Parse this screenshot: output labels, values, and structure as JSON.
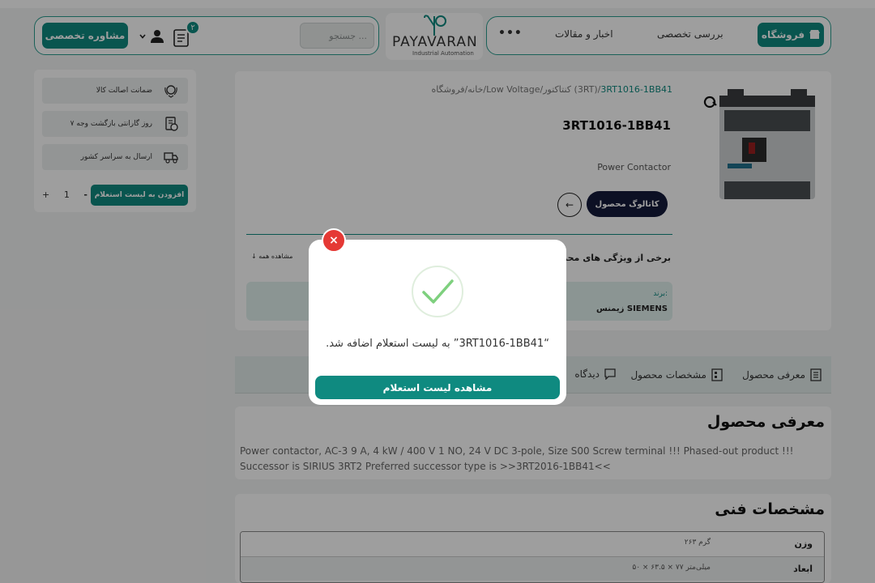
{
  "header": {
    "consult_label": "مشاوره تخصصی",
    "cart_count": "۲",
    "search_placeholder": "جستجو ...",
    "logo_text": "PAYAVARAN",
    "logo_sub": "Industrial Automation",
    "shop_label": "فروشگاه",
    "nav": [
      "بررسی تخصصی",
      "اخبار و مقالات"
    ],
    "more": "•••",
    "accent_color": "#0f8a80"
  },
  "sidebar": {
    "items": [
      {
        "label": "ضمانت اصالت کالا",
        "icon": "badge-icon"
      },
      {
        "label": "۷ روز گارانتی بازگشت وجه",
        "icon": "refund-doc-icon"
      },
      {
        "label": "ارسال به سراسر کشور",
        "icon": "delivery-icon"
      }
    ],
    "add_label": "افزودن به لیست استعلام",
    "qty_minus": "-",
    "qty_value": "1",
    "qty_plus": "+"
  },
  "product": {
    "breadcrumb_prefix": "خانه/فروشگاه/Low Voltage/کنتاکتور (3RT)/",
    "breadcrumb_current": "3RT1016-1BB41",
    "title": "3RT1016-1BB41",
    "subtitle": "Power Contactor",
    "catalog_label": "کاتالوگ محصول",
    "arrow": "←",
    "features_label": "برخی از ویژگی های محصول",
    "view_all": "مشاهده همه",
    "brand_label": "برند:",
    "brand_value": "زیمنس SIEMENS"
  },
  "tabs": [
    "معرفی محصول",
    "مشخصات محصول",
    "دیدگاه"
  ],
  "intro": {
    "title": "معرفی محصول",
    "text": "Power contactor, AC-3 9 A, 4 kW / 400 V 1 NO, 24 V DC 3-pole, Size S00 Screw terminal !!! Phased-out product !!! Successor is SIRIUS 3RT2 Preferred successor type is >>3RT2016-1BB41<<"
  },
  "specs": {
    "title": "مشخصات فنی",
    "rows": [
      {
        "key": "وزن",
        "value": "۲۶۳ گرم"
      },
      {
        "key": "ابعاد",
        "value": "۵۰ × ۶۳.۵ × ۷۷ میلی‌متر"
      }
    ]
  },
  "modal": {
    "close": "×",
    "message": "“3RT1016-1BB41” به لیست استعلام اضافه شد.",
    "button_label": "مشاهده لیست استعلام",
    "close_color": "#e53935",
    "check_color": "#7ed07e"
  }
}
